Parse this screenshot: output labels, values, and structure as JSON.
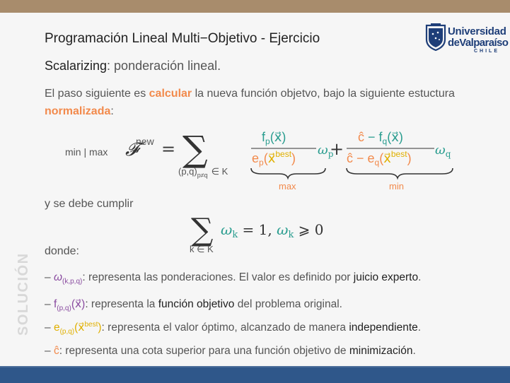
{
  "slide": {
    "title": "Programación Lineal Multi−Objetivo - Ejercicio",
    "subtitle_keyword": "Scalarizing",
    "subtitle_rest": ": ponderación lineal.",
    "para_part1": "El paso siguiente es ",
    "para_highlight1": "calcular",
    "para_part2": " la nueva función objetvo, bajo la siguiente estuctura ",
    "para_highlight2": "normalizada",
    "para_part3": ":",
    "cumplir": "y se debe cumplir",
    "donde": "donde:",
    "side_label": "SOLUCIÓN"
  },
  "logo": {
    "line1": "Universidad",
    "line2": "deValparaíso",
    "line3": "CHILE"
  },
  "formula": {
    "minmax": "min | max",
    "script_f": "𝓕",
    "new_sup": "new",
    "equals": "=",
    "sum": "∑",
    "sum_index": "(p,q)",
    "sum_index_sub": "p≠q",
    "in_k": "∈ K",
    "frac1_num": "fp(x⃗)",
    "frac1_den": "ep(x⃗best)",
    "omega_p": "ωp",
    "plus": "+",
    "frac2_num": "ĉ − fq(x⃗)",
    "frac2_den": "ĉ − eq(x⃗best)",
    "omega_q": "ωq",
    "brace1_label": "max",
    "brace2_label": "min",
    "constraint": "ωk = 1,  ωk ⩾ 0",
    "constraint_index": "k ∈ K"
  },
  "items": [
    {
      "dash": "– ",
      "sym": "ω",
      "sub": "(k,p,q)",
      "text": ": representa las ponderaciones. El valor es definido por ",
      "bold": "juicio experto",
      "end": "."
    },
    {
      "dash": "– ",
      "sym": "f",
      "sub": "(p,q)",
      "arg": "(x⃗)",
      "text": ": representa la ",
      "bold": "función objetivo",
      "end": " del problema original."
    },
    {
      "dash": "– ",
      "sym": "e",
      "sub": "(p,q)",
      "arg": "(x⃗",
      "sup": "best",
      "argend": ")",
      "text": ": representa el valor óptimo, alcanzado de manera ",
      "bold": "independiente",
      "end": "."
    },
    {
      "dash": "– ",
      "sym": "ĉ",
      "text": ": representa una cota superior para una función objetivo de ",
      "bold": "minimización",
      "end": "."
    }
  ],
  "colors": {
    "accent_orange": "#f28a4c",
    "yellow": "#e0b000",
    "purple": "#8a4ca0",
    "top_bar": "#a88c6c",
    "bottom_bar": "#2f578a"
  }
}
